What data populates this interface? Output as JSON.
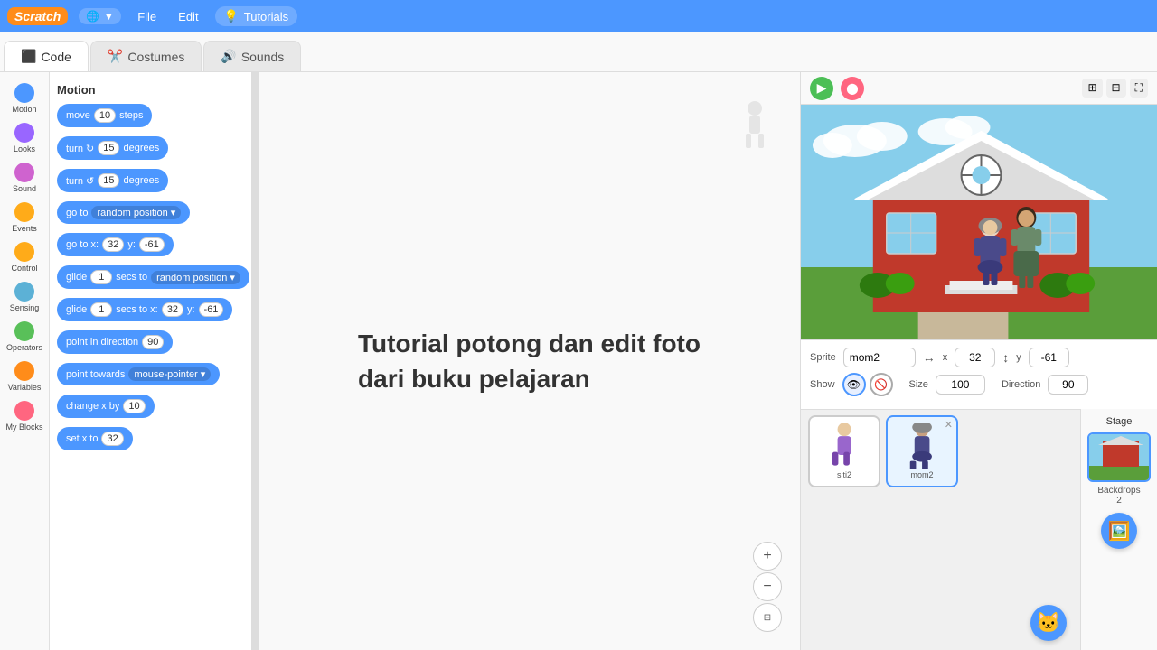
{
  "topbar": {
    "logo": "Scratch",
    "globe_label": "▼",
    "file_label": "File",
    "edit_label": "Edit",
    "tutorials_icon": "💡",
    "tutorials_label": "Tutorials"
  },
  "tabs": [
    {
      "id": "code",
      "label": "Code",
      "icon": "⬛",
      "active": true
    },
    {
      "id": "costumes",
      "label": "Costumes",
      "icon": "✂️",
      "active": false
    },
    {
      "id": "sounds",
      "label": "Sounds",
      "icon": "🔊",
      "active": false
    }
  ],
  "categories": [
    {
      "id": "motion",
      "label": "Motion",
      "color": "#4c97ff"
    },
    {
      "id": "looks",
      "label": "Looks",
      "color": "#9966ff"
    },
    {
      "id": "sound",
      "label": "Sound",
      "color": "#cf63cf"
    },
    {
      "id": "events",
      "label": "Events",
      "color": "#ffab19"
    },
    {
      "id": "control",
      "label": "Control",
      "color": "#ffab19"
    },
    {
      "id": "sensing",
      "label": "Sensing",
      "color": "#5cb1d6"
    },
    {
      "id": "operators",
      "label": "Operators",
      "color": "#59c059"
    },
    {
      "id": "variables",
      "label": "Variables",
      "color": "#ff8c1a"
    },
    {
      "id": "myblocks",
      "label": "My Blocks",
      "color": "#ff6680"
    }
  ],
  "blocks": {
    "category": "Motion",
    "items": [
      {
        "type": "move",
        "label": "move",
        "value": "10",
        "suffix": "steps"
      },
      {
        "type": "turn_cw",
        "label": "turn ↻",
        "value": "15",
        "suffix": "degrees"
      },
      {
        "type": "turn_ccw",
        "label": "turn ↺",
        "value": "15",
        "suffix": "degrees"
      },
      {
        "type": "goto",
        "label": "go to",
        "dropdown": "random position"
      },
      {
        "type": "goto_xy",
        "label": "go to x:",
        "x": "32",
        "y": "-61"
      },
      {
        "type": "glide",
        "label": "glide",
        "secs": "1",
        "suffix": "secs to",
        "dropdown": "random position"
      },
      {
        "type": "glide_xy",
        "label": "glide",
        "secs": "1",
        "suffix": "secs to x:",
        "x": "32",
        "y": "-61"
      },
      {
        "type": "point_dir",
        "label": "point in direction",
        "value": "90"
      },
      {
        "type": "point_towards",
        "label": "point towards",
        "dropdown": "mouse-pointer"
      },
      {
        "type": "change_x",
        "label": "change x by",
        "value": "10"
      },
      {
        "type": "set_x",
        "label": "set x to",
        "value": "32"
      }
    ]
  },
  "tutorial_text": {
    "line1": "Tutorial potong dan edit foto",
    "line2": "dari buku pelajaran"
  },
  "stage": {
    "sprite_name": "mom2",
    "x": "32",
    "y": "-61",
    "size": "100",
    "direction": "90",
    "show": true
  },
  "sprites": [
    {
      "name": "siti2",
      "selected": false
    },
    {
      "name": "mom2",
      "selected": true
    }
  ],
  "backdrops": {
    "label": "Backdrops",
    "count": "2"
  },
  "zoom_controls": {
    "zoom_in": "+",
    "zoom_out": "−",
    "fit": "⊟"
  }
}
